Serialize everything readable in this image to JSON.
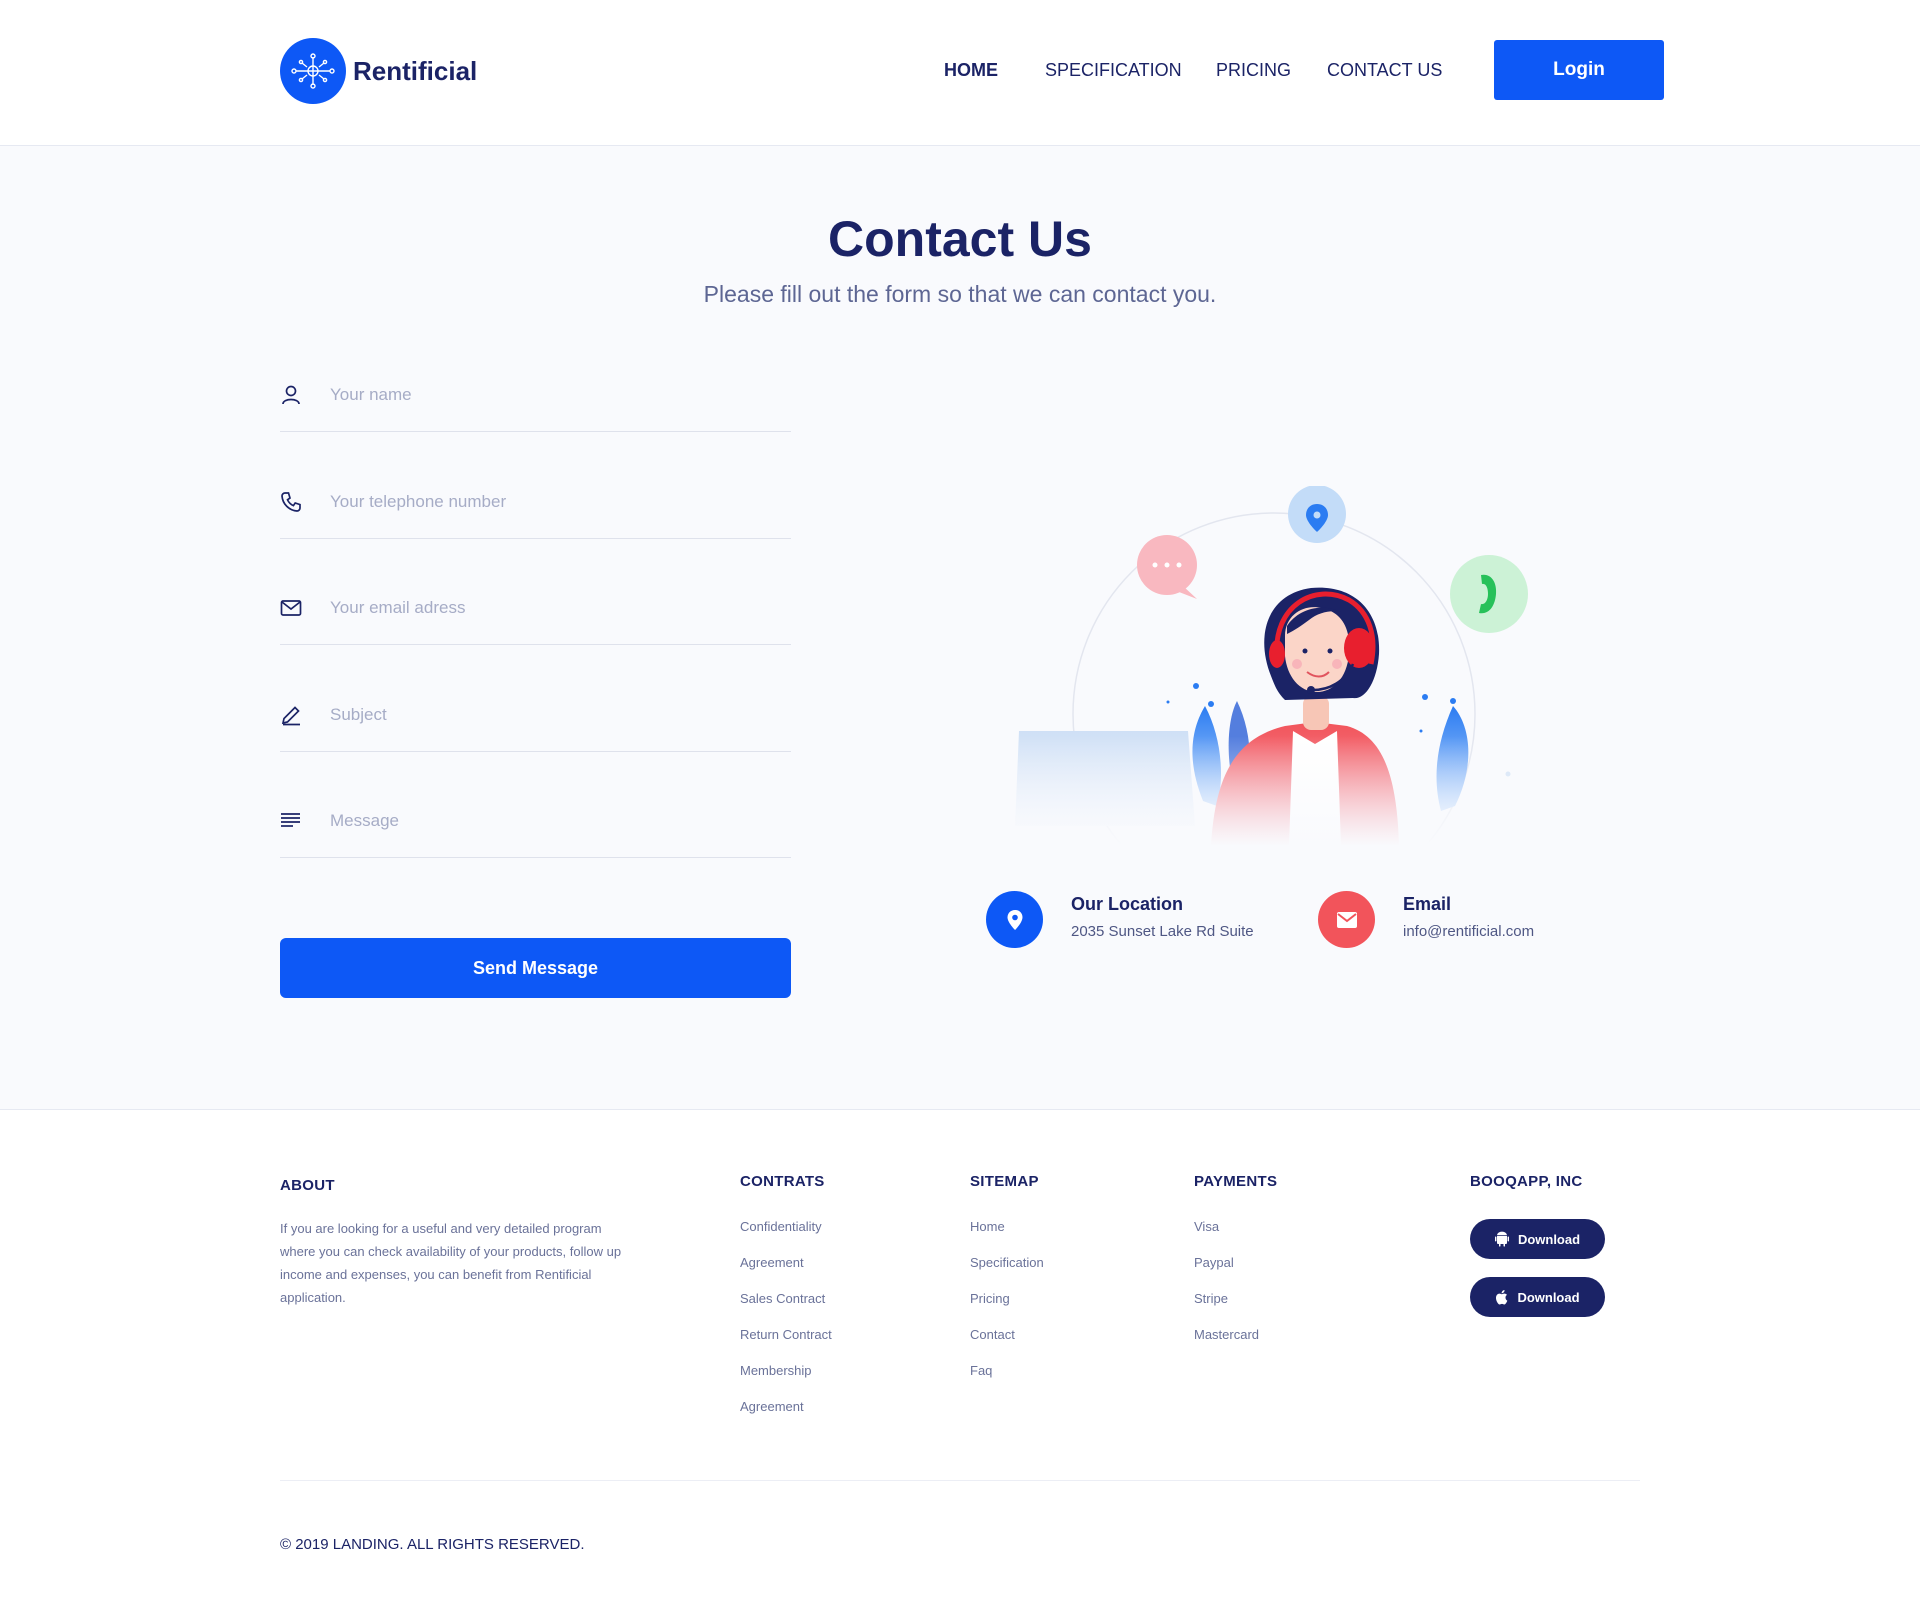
{
  "brand": {
    "name": "Rentificial",
    "logo_icon": "network-brain-icon",
    "accent": "#0d58f6",
    "navy": "#1b2366"
  },
  "nav": {
    "items": [
      {
        "label": "HOME",
        "active": true
      },
      {
        "label": "SPECIFICATION"
      },
      {
        "label": "PRICING"
      },
      {
        "label": "CONTACT US"
      }
    ],
    "login_label": "Login"
  },
  "contact": {
    "title": "Contact Us",
    "subtitle": "Please fill out the form so that we can contact you.",
    "fields": [
      {
        "icon": "user-icon",
        "placeholder": "Your name",
        "value": ""
      },
      {
        "icon": "phone-icon",
        "placeholder": "Your telephone number",
        "value": ""
      },
      {
        "icon": "envelope-icon",
        "placeholder": "Your email adress",
        "value": ""
      },
      {
        "icon": "pen-icon",
        "placeholder": "Subject",
        "value": ""
      },
      {
        "icon": "text-lines-icon",
        "placeholder": "Message",
        "value": ""
      }
    ],
    "send_label": "Send Message",
    "location": {
      "title": "Our Location",
      "value": "2035 Sunset Lake Rd Suite",
      "color": "#0d58f6",
      "icon": "map-pin-icon"
    },
    "email": {
      "title": "Email",
      "value": "info@rentificial.com",
      "color": "#f2545b",
      "icon": "mail-icon"
    }
  },
  "footer": {
    "about": {
      "heading": "ABOUT",
      "text": "If you are looking for a useful and very detailed program where you can check availability of your products, follow up income and expenses, you can benefit from Rentificial application."
    },
    "columns": [
      {
        "heading": "CONTRATS",
        "links": [
          "Confidentiality",
          "Agreement",
          "Sales Contract",
          "Return Contract",
          "Membership",
          "Agreement"
        ]
      },
      {
        "heading": "SITEMAP",
        "links": [
          "Home",
          "Specification",
          "Pricing",
          "Contact",
          "Faq"
        ]
      },
      {
        "heading": "PAYMENTS",
        "links": [
          "Visa",
          "Paypal",
          "Stripe",
          "Mastercard"
        ]
      }
    ],
    "company": {
      "heading": "BOOQAPP, INC",
      "buttons": [
        {
          "label": "Download",
          "icon": "android-icon"
        },
        {
          "label": "Download",
          "icon": "apple-icon"
        }
      ]
    },
    "copyright": "© 2019 LANDING. ALL RIGHTS RESERVED."
  }
}
